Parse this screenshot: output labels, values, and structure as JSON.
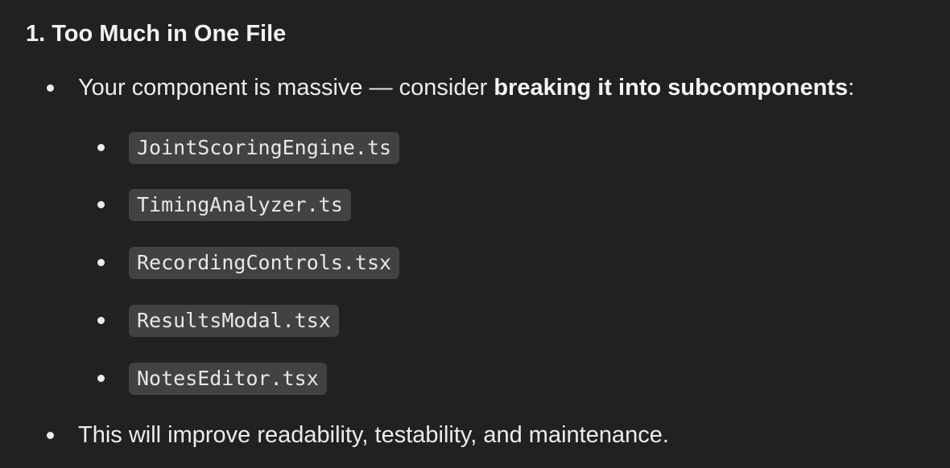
{
  "section": {
    "heading": "1. Too Much in One File"
  },
  "points": {
    "first": {
      "before": "Your component is massive — consider ",
      "bold": "breaking it into subcomponents",
      "after": ":"
    },
    "files": [
      "JointScoringEngine.ts",
      "TimingAnalyzer.ts",
      "RecordingControls.tsx",
      "ResultsModal.tsx",
      "NotesEditor.tsx"
    ],
    "last": "This will improve readability, testability, and maintenance."
  }
}
